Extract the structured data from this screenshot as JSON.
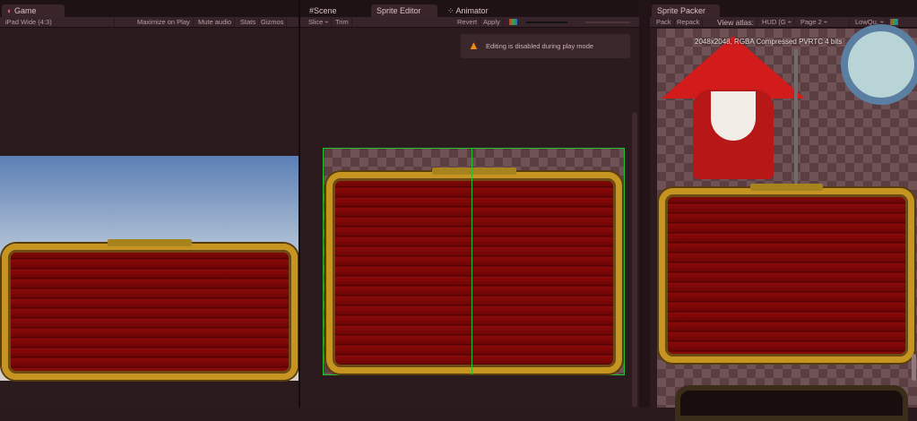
{
  "game": {
    "tab": "Game",
    "aspect": "iPad Wide (4:3)",
    "maximize": "Maximize on Play",
    "mute": "Mute audio",
    "stats": "Stats",
    "gizmos": "Gizmos"
  },
  "editor": {
    "tabs": [
      "Scene",
      "Sprite Editor",
      "Animator"
    ],
    "active_tab": "Sprite Editor",
    "slice": "Slice ÷",
    "trim": "Trim",
    "revert": "Revert",
    "apply": "Apply",
    "warning": "Editing is disabled during play mode"
  },
  "packer": {
    "tab": "Sprite Packer",
    "pack": "Pack",
    "repack": "Repack",
    "view_atlas_label": "View atlas:",
    "atlas": "HUD (G ÷",
    "page": "Page 2 ÷",
    "quality": "LowQu. ÷",
    "info": "2048x2048, RGBA Compressed PVRTC 4 bits"
  },
  "colors": {
    "accent_green": "#22c02a",
    "warning": "#f08a10"
  }
}
